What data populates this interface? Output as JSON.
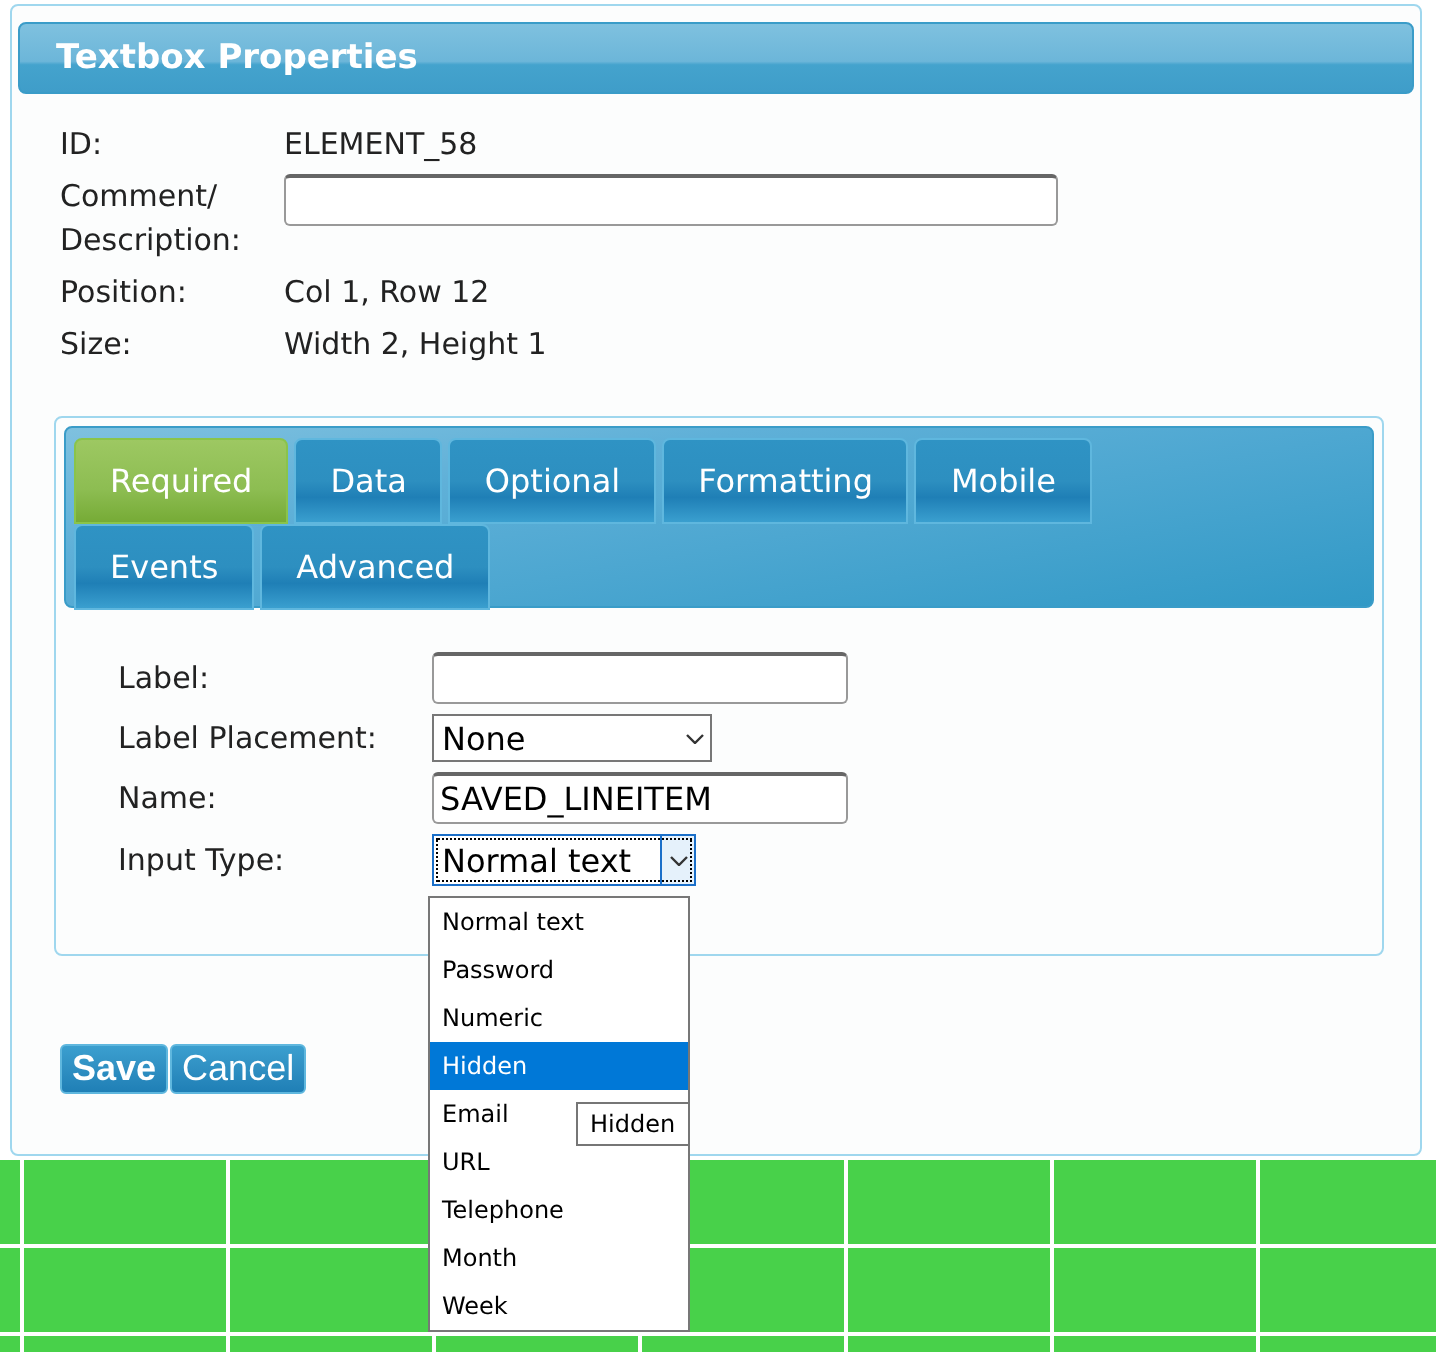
{
  "dialog": {
    "title": "Textbox Properties"
  },
  "info": [
    {
      "kind": "text",
      "label": "ID:",
      "value": "ELEMENT_58"
    },
    {
      "kind": "input",
      "label": "Comment/ Description:"
    },
    {
      "kind": "text",
      "label": "Position:",
      "value": "Col 1, Row 12"
    },
    {
      "kind": "text",
      "label": "Size:",
      "value": "Width 2, Height 1"
    }
  ],
  "tabs": [
    [
      {
        "label": "Required",
        "selected": true
      },
      {
        "label": "Data",
        "selected": false
      },
      {
        "label": "Optional",
        "selected": false
      },
      {
        "label": "Formatting",
        "selected": false
      },
      {
        "label": "Mobile",
        "selected": false
      }
    ],
    [
      {
        "label": "Events",
        "selected": false
      },
      {
        "label": "Advanced",
        "selected": false
      }
    ]
  ],
  "fields": [
    {
      "kind": "input",
      "label": "Label:"
    },
    {
      "kind": "select",
      "label": "Label Placement:",
      "value": "None"
    },
    {
      "kind": "input",
      "label": "Name:",
      "value": "SAVED_LINEITEM"
    },
    {
      "kind": "select",
      "label": "Input Type:",
      "value": "Normal text",
      "focused": true
    }
  ],
  "dropdown": {
    "options": [
      {
        "label": "Normal text",
        "selected": false
      },
      {
        "label": "Password",
        "selected": false
      },
      {
        "label": "Numeric",
        "selected": false
      },
      {
        "label": "Hidden",
        "selected": true
      },
      {
        "label": "Email",
        "selected": false
      },
      {
        "label": "URL",
        "selected": false
      },
      {
        "label": "Telephone",
        "selected": false
      },
      {
        "label": "Month",
        "selected": false
      },
      {
        "label": "Week",
        "selected": false
      }
    ],
    "tooltip": "Hidden"
  },
  "buttons": [
    "Save",
    "Cancel"
  ]
}
